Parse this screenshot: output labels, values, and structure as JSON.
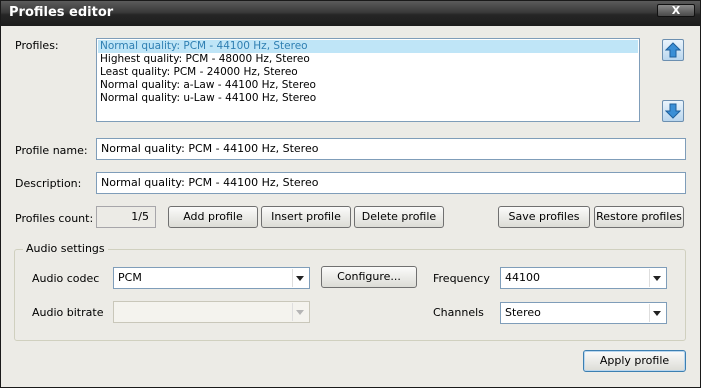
{
  "window": {
    "title": "Profiles editor",
    "close_glyph": "X"
  },
  "profiles": {
    "label": "Profiles:",
    "items": [
      "Normal quality: PCM - 44100 Hz, Stereo",
      "Highest quality: PCM - 48000 Hz, Stereo",
      "Least quality: PCM - 24000 Hz, Stereo",
      "Normal quality: a-Law - 44100 Hz, Stereo",
      "Normal quality: u-Law - 44100 Hz, Stereo"
    ],
    "selected_index": 0,
    "move_up_icon": "arrow-up-icon",
    "move_down_icon": "arrow-down-icon"
  },
  "profile_name": {
    "label": "Profile name:",
    "value": "Normal quality: PCM - 44100 Hz, Stereo"
  },
  "description": {
    "label": "Description:",
    "value": "Normal quality: PCM - 44100 Hz, Stereo"
  },
  "count": {
    "label": "Profiles count:",
    "value": "1/5"
  },
  "buttons": {
    "add": "Add profile",
    "insert": "Insert profile",
    "delete": "Delete profile",
    "save": "Save profiles",
    "restore": "Restore profiles",
    "configure": "Configure...",
    "apply": "Apply profile"
  },
  "audio": {
    "group_title": "Audio settings",
    "codec_label": "Audio codec",
    "codec_value": "PCM",
    "bitrate_label": "Audio bitrate",
    "bitrate_value": "",
    "frequency_label": "Frequency",
    "frequency_value": "44100",
    "channels_label": "Channels",
    "channels_value": "Stereo"
  },
  "colors": {
    "title_bar": "#2a2a2a",
    "selection_bg": "#bfe5f7",
    "selection_text": "#2f7fb2",
    "dialog_bg": "#ecebe6"
  }
}
